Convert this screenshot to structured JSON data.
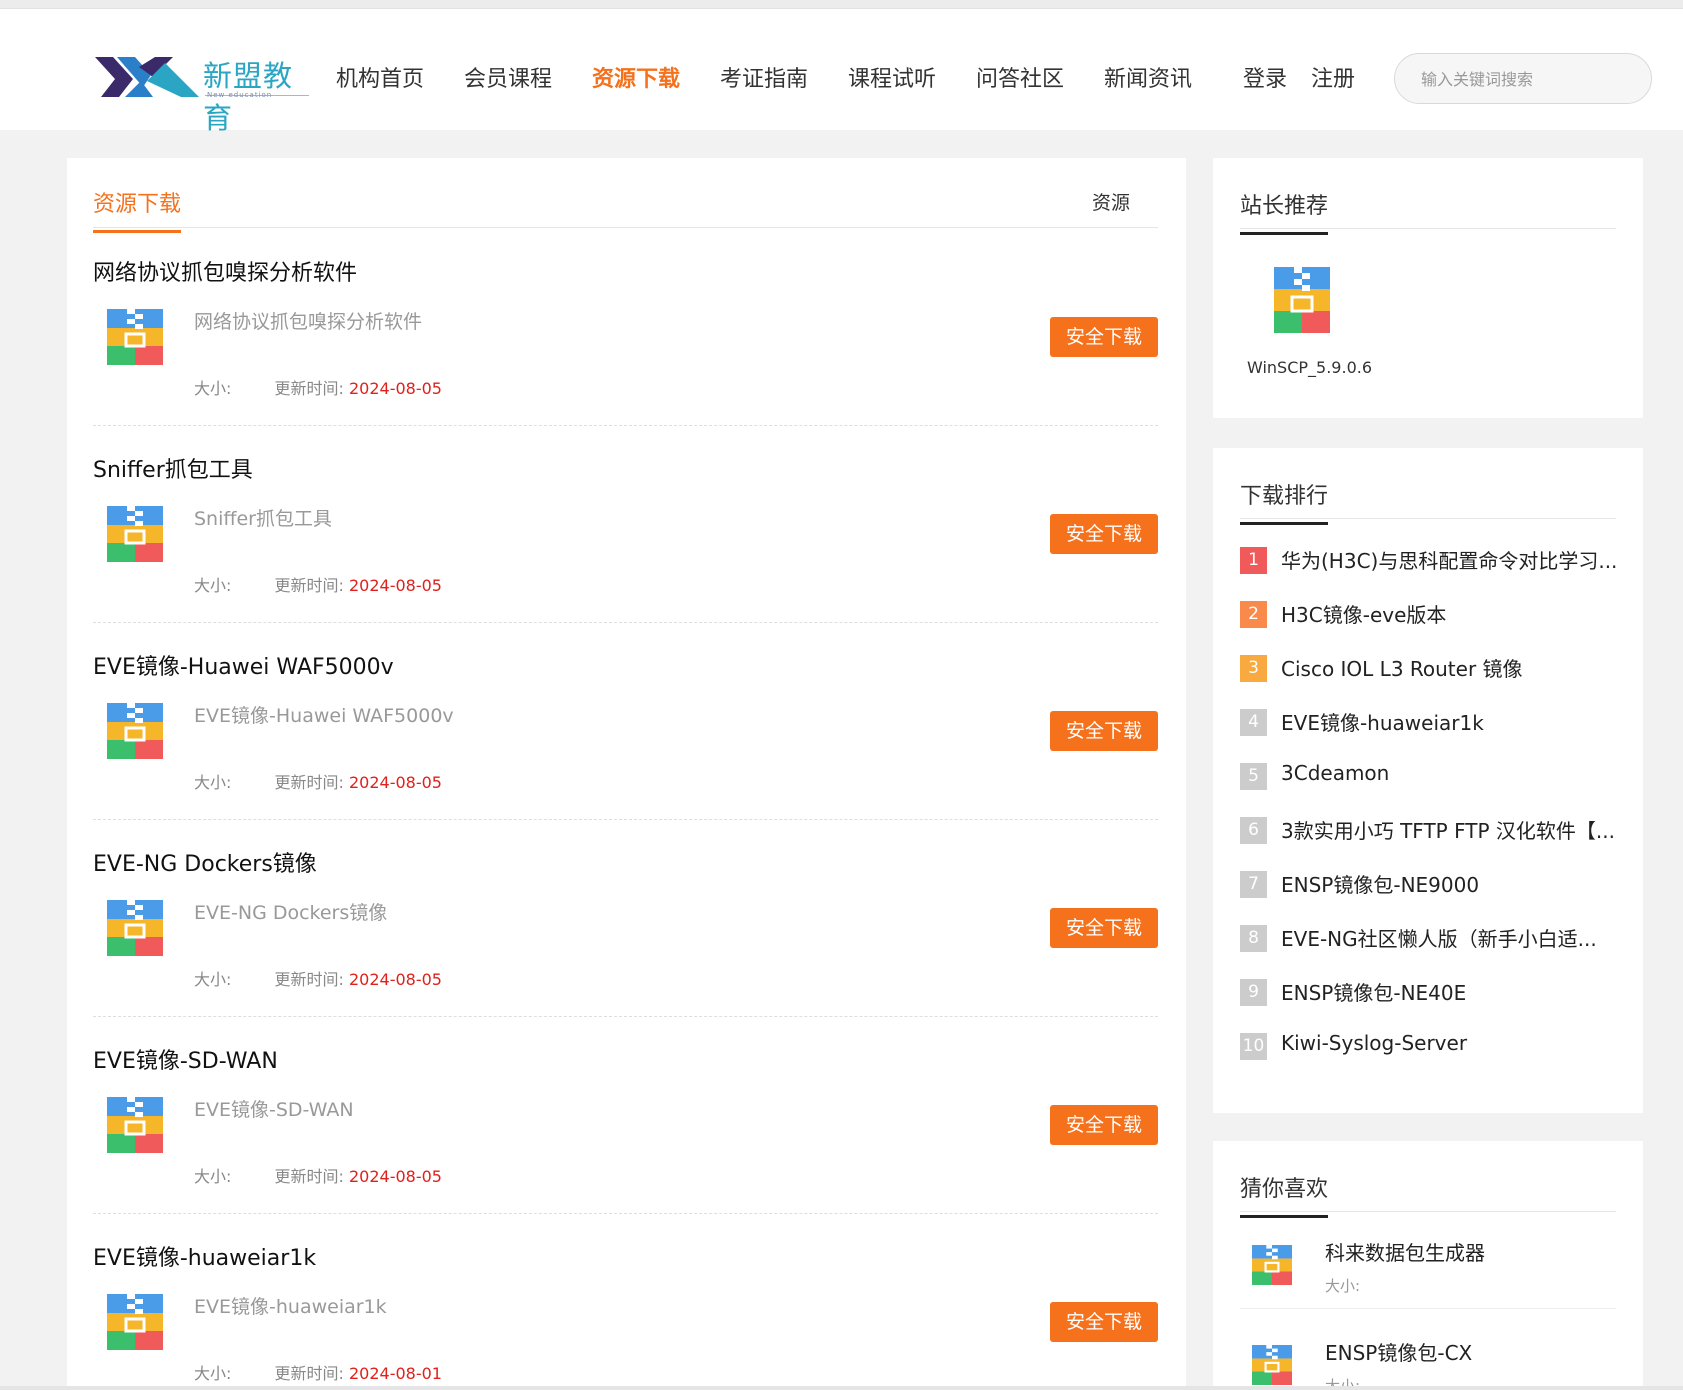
{
  "header": {
    "logo_text": "新盟教育",
    "logo_sub": "New education",
    "nav": [
      {
        "label": "机构首页",
        "active": false
      },
      {
        "label": "会员课程",
        "active": false
      },
      {
        "label": "资源下载",
        "active": true
      },
      {
        "label": "考证指南",
        "active": false
      },
      {
        "label": "课程试听",
        "active": false
      },
      {
        "label": "问答社区",
        "active": false
      },
      {
        "label": "新闻资讯",
        "active": false
      }
    ],
    "login": "登录",
    "register": "注册",
    "search_placeholder": "输入关键词搜索"
  },
  "main": {
    "title": "资源下载",
    "right_label": "资源",
    "size_label": "大小:",
    "updated_label": "更新时间:",
    "button_label": "安全下载",
    "items": [
      {
        "title": "网络协议抓包嗅探分析软件",
        "desc": "网络协议抓包嗅探分析软件",
        "date": "2024-08-05"
      },
      {
        "title": "Sniffer抓包工具",
        "desc": "Sniffer抓包工具",
        "date": "2024-08-05"
      },
      {
        "title": "EVE镜像-Huawei WAF5000v",
        "desc": "EVE镜像-Huawei WAF5000v",
        "date": "2024-08-05"
      },
      {
        "title": "EVE-NG Dockers镜像",
        "desc": "EVE-NG Dockers镜像",
        "date": "2024-08-05"
      },
      {
        "title": "EVE镜像-SD-WAN",
        "desc": "EVE镜像-SD-WAN",
        "date": "2024-08-05"
      },
      {
        "title": "EVE镜像-huaweiar1k",
        "desc": "EVE镜像-huaweiar1k",
        "date": "2024-08-01"
      }
    ]
  },
  "recommend": {
    "title": "站长推荐",
    "item_name": "WinSCP_5.9.0.6"
  },
  "ranking": {
    "title": "下载排行",
    "items": [
      {
        "num": "1",
        "label": "华为(H3C)与思科配置命令对比学习...",
        "color": "#f05a5a"
      },
      {
        "num": "2",
        "label": "H3C镜像-eve版本",
        "color": "#fa8a4b"
      },
      {
        "num": "3",
        "label": "Cisco IOL L3 Router 镜像",
        "color": "#f8a93f"
      },
      {
        "num": "4",
        "label": "EVE镜像-huaweiar1k",
        "color": "#cccccc"
      },
      {
        "num": "5",
        "label": "3Cdeamon",
        "color": "#cccccc"
      },
      {
        "num": "6",
        "label": "3款实用小巧 TFTP FTP 汉化软件【...",
        "color": "#cccccc"
      },
      {
        "num": "7",
        "label": "ENSP镜像包-NE9000",
        "color": "#cccccc"
      },
      {
        "num": "8",
        "label": "EVE-NG社区懒人版（新手小白适...",
        "color": "#cccccc"
      },
      {
        "num": "9",
        "label": "ENSP镜像包-NE40E",
        "color": "#cccccc"
      },
      {
        "num": "10",
        "label": "Kiwi-Syslog-Server",
        "color": "#cccccc"
      }
    ]
  },
  "guess": {
    "title": "猜你喜欢",
    "size_label": "大小:",
    "items": [
      {
        "title": "科来数据包生成器"
      },
      {
        "title": "ENSP镜像包-CX"
      }
    ]
  }
}
